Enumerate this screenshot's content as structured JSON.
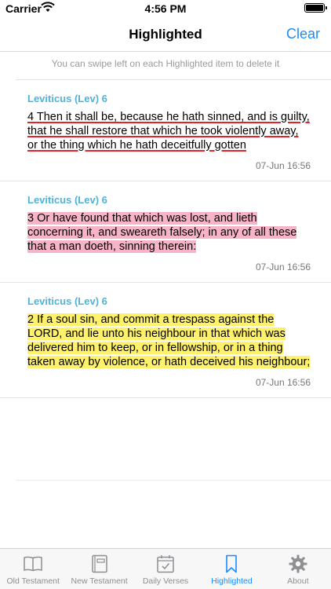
{
  "status_bar": {
    "carrier": "Carrier",
    "time": "4:56 PM"
  },
  "nav": {
    "title": "Highlighted",
    "clear_label": "Clear"
  },
  "hint": "You can swipe left on each Highlighted item to delete it",
  "items": [
    {
      "reference": "Leviticus (Lev) 6",
      "text": "4 Then it shall be, because he hath sinned, and is guilty, that he shall restore that which he took violently away, or the thing which he hath deceitfully gotten",
      "style": "underline",
      "timestamp": "07-Jun 16:56"
    },
    {
      "reference": "Leviticus (Lev) 6",
      "text": "3 Or have found that which was lost, and lieth concerning it, and sweareth falsely; in any of all these that a man doeth, sinning therein:",
      "style": "pink",
      "timestamp": "07-Jun 16:56"
    },
    {
      "reference": "Leviticus (Lev) 6",
      "text": "2 If a soul sin, and commit a trespass against the LORD, and lie unto his neighbour in that which was delivered him to keep, or in fellowship, or in a thing taken away by violence, or hath deceived his neighbour;",
      "style": "yellow",
      "timestamp": "07-Jun 16:56"
    }
  ],
  "tabs": [
    {
      "label": "Old Testament",
      "icon": "open-book-icon",
      "active": false
    },
    {
      "label": "New Testament",
      "icon": "closed-book-icon",
      "active": false
    },
    {
      "label": "Daily Verses",
      "icon": "calendar-check-icon",
      "active": false
    },
    {
      "label": "Highlighted",
      "icon": "bookmark-icon",
      "active": true
    },
    {
      "label": "About",
      "icon": "gear-icon",
      "active": false
    }
  ],
  "colors": {
    "accent": "#1a8cff",
    "reference": "#4fb3d9",
    "underline": "#e0242a",
    "pink_highlight": "#f7b4c8",
    "yellow_highlight": "#fff26a"
  }
}
